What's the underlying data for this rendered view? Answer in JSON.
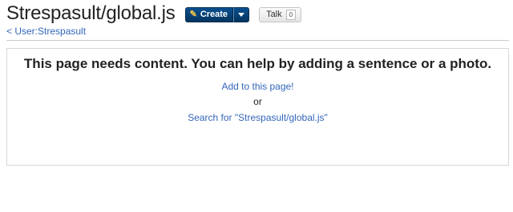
{
  "header": {
    "title": "Strespasult/global.js",
    "create_label": "Create",
    "talk_label": "Talk",
    "talk_count": "0"
  },
  "breadcrumb": {
    "text": "< User:Strespasult"
  },
  "main": {
    "headline": "This page needs content. You can help by adding a sentence or a photo.",
    "add_link": "Add to this page!",
    "or_text": "or",
    "search_link": "Search for \"Strespasult/global.js\""
  },
  "icons": {
    "create": "pencil-icon",
    "dropdown": "caret-down-icon"
  },
  "colors": {
    "link": "#3366bb",
    "create_button": "#0a4f8f",
    "pencil": "#f2c14e"
  }
}
